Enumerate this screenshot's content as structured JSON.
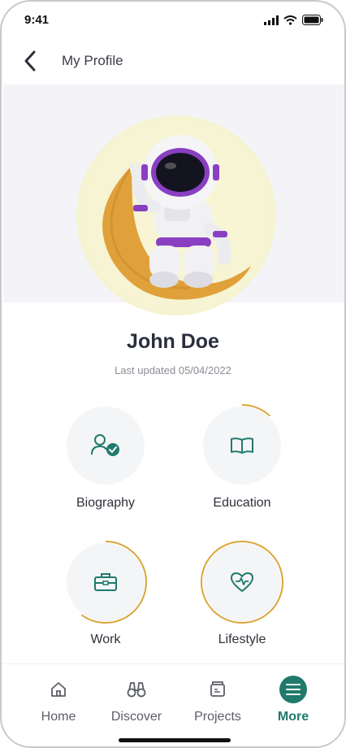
{
  "status_bar": {
    "time": "9:41"
  },
  "header": {
    "title": "My Profile"
  },
  "profile": {
    "name": "John Doe",
    "last_updated": "Last updated 05/04/2022"
  },
  "categories": [
    {
      "label": "Biography",
      "icon": "user-check-icon",
      "progress": 0
    },
    {
      "label": "Education",
      "icon": "book-icon",
      "progress": 0.12
    },
    {
      "label": "Work",
      "icon": "briefcase-icon",
      "progress": 0.6
    },
    {
      "label": "Lifestyle",
      "icon": "heart-pulse-icon",
      "progress": 1.0
    }
  ],
  "bottom_nav": {
    "items": [
      {
        "label": "Home",
        "icon": "home-icon"
      },
      {
        "label": "Discover",
        "icon": "binoculars-icon"
      },
      {
        "label": "Projects",
        "icon": "folder-icon"
      },
      {
        "label": "More",
        "icon": "menu-icon",
        "active": true
      }
    ]
  },
  "colors": {
    "accent": "#1f7a6b",
    "progress": "#d9a63a",
    "hero_bg": "#f4f4f8"
  }
}
